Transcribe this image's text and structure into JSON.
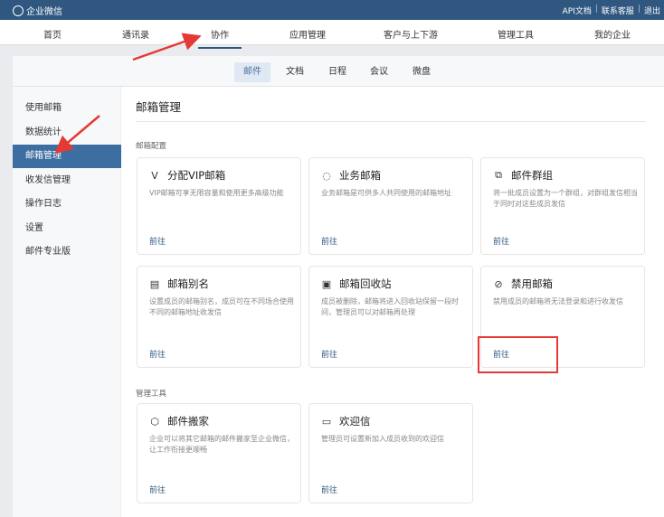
{
  "topbar": {
    "brand": "企业微信",
    "links": [
      "API文档",
      "联系客服",
      "退出"
    ]
  },
  "nav": {
    "items": [
      "首页",
      "通讯录",
      "协作",
      "应用管理",
      "客户与上下游",
      "管理工具",
      "我的企业"
    ],
    "active": 2
  },
  "subtabs": {
    "items": [
      "邮件",
      "文档",
      "日程",
      "会议",
      "微盘"
    ],
    "active": 0
  },
  "sidebar": {
    "items": [
      "使用邮箱",
      "数据统计",
      "邮箱管理",
      "收发信管理",
      "操作日志",
      "设置",
      "邮件专业版"
    ],
    "active": 2
  },
  "main": {
    "title": "邮箱管理",
    "sections": [
      {
        "label": "邮箱配置",
        "cards": [
          {
            "icon": "vip-icon",
            "title": "分配VIP邮箱",
            "desc": "VIP邮箱可享无限容量和使用更多高级功能",
            "link": "前往"
          },
          {
            "icon": "business-mail-icon",
            "title": "业务邮箱",
            "desc": "业务邮箱是可供多人共同使用的邮箱地址",
            "link": "前往"
          },
          {
            "icon": "group-icon",
            "title": "邮件群组",
            "desc": "将一批成员设置为一个群组，对群组发信相当于同时对这些成员发信",
            "link": "前往"
          },
          {
            "icon": "alias-icon",
            "title": "邮箱别名",
            "desc": "设置成员的邮箱别名，成员可在不同场合使用不同的邮箱地址收发信",
            "link": "前往"
          },
          {
            "icon": "recycle-icon",
            "title": "邮箱回收站",
            "desc": "成员被删除，邮箱将进入回收站保留一段时间，管理员可以对邮箱再处理",
            "link": "前往"
          },
          {
            "icon": "disable-icon",
            "title": "禁用邮箱",
            "desc": "禁用成员的邮箱将无法登录和进行收发信",
            "link": "前往"
          }
        ]
      },
      {
        "label": "管理工具",
        "cards": [
          {
            "icon": "migrate-icon",
            "title": "邮件搬家",
            "desc": "企业可以将其它邮箱的邮件搬家至企业微信，让工作衔接更顺畅",
            "link": "前往"
          },
          {
            "icon": "welcome-icon",
            "title": "欢迎信",
            "desc": "管理员可设置新加入成员收到的欢迎信",
            "link": "前往"
          }
        ]
      }
    ]
  },
  "colors": {
    "topbar": "#2f5780",
    "accent": "#3d6ea1",
    "annotation": "#e53935"
  }
}
